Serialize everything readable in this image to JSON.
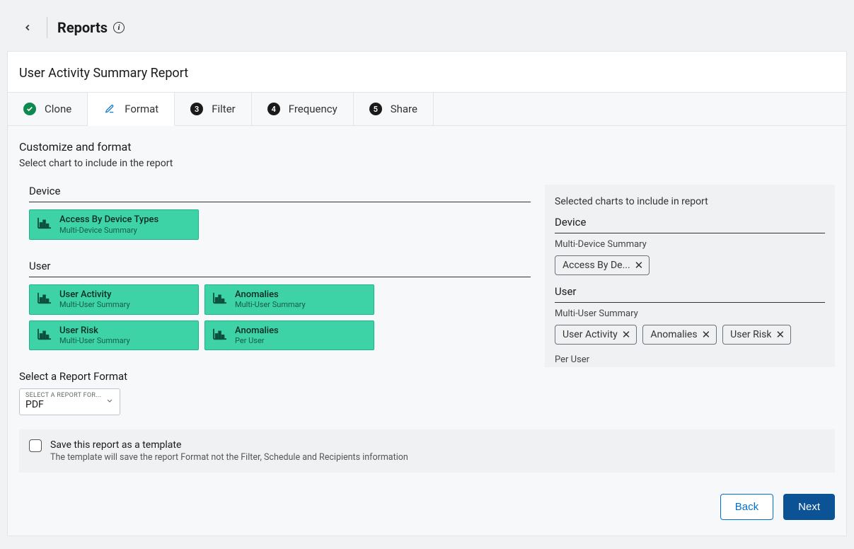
{
  "header": {
    "title": "Reports"
  },
  "report_title": "User Activity Summary Report",
  "tabs": [
    {
      "label": "Clone",
      "state": "done"
    },
    {
      "label": "Format",
      "state": "active"
    },
    {
      "label": "Filter",
      "num": "3"
    },
    {
      "label": "Frequency",
      "num": "4"
    },
    {
      "label": "Share",
      "num": "5"
    }
  ],
  "section": {
    "heading": "Customize and format",
    "subheading": "Select chart to include in the report"
  },
  "left": {
    "groups": [
      {
        "label": "Device",
        "tiles": [
          {
            "title": "Access By Device Types",
            "sub": "Multi-Device Summary"
          }
        ]
      },
      {
        "label": "User",
        "tiles": [
          {
            "title": "User Activity",
            "sub": "Multi-User Summary"
          },
          {
            "title": "Anomalies",
            "sub": "Multi-User Summary"
          },
          {
            "title": "User Risk",
            "sub": "Multi-User Summary"
          },
          {
            "title": "Anomalies",
            "sub": "Per User"
          }
        ]
      }
    ]
  },
  "right": {
    "heading": "Selected charts to include in report",
    "groups": [
      {
        "label": "Device",
        "subgroups": [
          {
            "label": "Multi-Device Summary",
            "chips": [
              "Access By De..."
            ]
          }
        ]
      },
      {
        "label": "User",
        "subgroups": [
          {
            "label": "Multi-User Summary",
            "chips": [
              "User Activity",
              "Anomalies",
              "User Risk"
            ]
          },
          {
            "label": "Per User",
            "chips": []
          }
        ]
      }
    ]
  },
  "format": {
    "label": "Select a Report Format",
    "placeholder": "SELECT A REPORT FOR...",
    "value": "PDF"
  },
  "save_template": {
    "title": "Save this report as a template",
    "desc": "The template will save the report Format not the Filter, Schedule and Recipients information"
  },
  "buttons": {
    "back": "Back",
    "next": "Next"
  }
}
